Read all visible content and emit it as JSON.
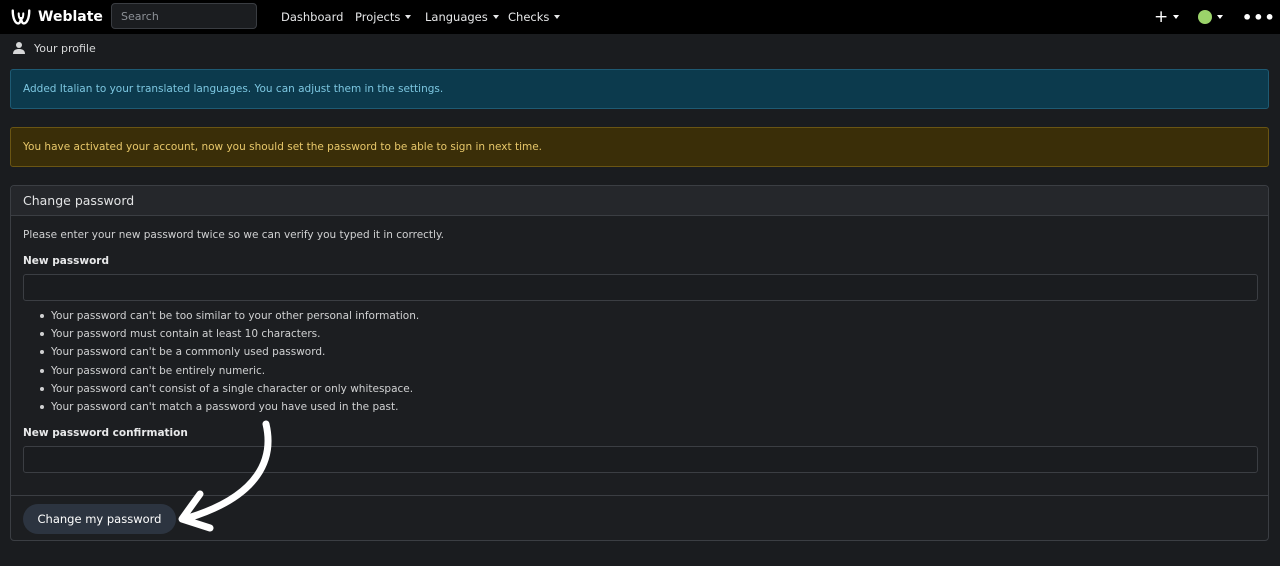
{
  "brand": {
    "name": "Weblate"
  },
  "search": {
    "placeholder": "Search"
  },
  "nav": {
    "dashboard": "Dashboard",
    "projects": "Projects",
    "languages": "Languages",
    "checks": "Checks"
  },
  "breadcrumb": {
    "label": "Your profile"
  },
  "alerts": {
    "info": "Added Italian to your translated languages. You can adjust them in the settings.",
    "warning": "You have activated your account, now you should set the password to be able to sign in next time."
  },
  "form": {
    "title": "Change password",
    "intro": "Please enter your new password twice so we can verify you typed it in correctly.",
    "new_password_label": "New password",
    "hints": [
      "Your password can't be too similar to your other personal information.",
      "Your password must contain at least 10 characters.",
      "Your password can't be a commonly used password.",
      "Your password can't be entirely numeric.",
      "Your password can't consist of a single character or only whitespace.",
      "Your password can't match a password you have used in the past."
    ],
    "confirm_label": "New password confirmation",
    "submit_label": "Change my password"
  },
  "icons": {
    "logo": "weblate-logo-icon",
    "add": "plus-icon",
    "user": "user-icon",
    "menu": "more-dots-icon",
    "annotation": "curved-arrow-icon"
  },
  "colors": {
    "navbar": "#000000",
    "background": "#1a1c1f",
    "info_bg": "#0c3a4d",
    "info_text": "#7cc6e0",
    "warning_bg": "#3a2e08",
    "warning_text": "#e8c86a",
    "button_bg": "#2c3440",
    "avatar": "#9bd36a"
  }
}
